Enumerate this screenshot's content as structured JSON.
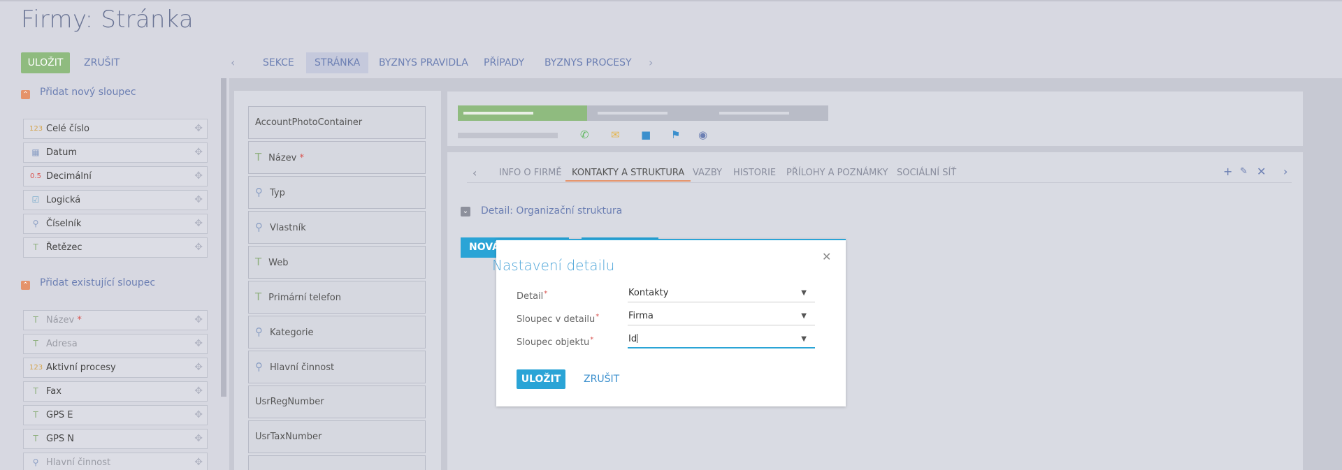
{
  "page": {
    "title": "Firmy: Stránka"
  },
  "toolbar": {
    "save_label": "ULOŽIT",
    "cancel_label": "ZRUŠIT"
  },
  "top_tabs": [
    "SEKCE",
    "STRÁNKA",
    "BYZNYS PRAVIDLA",
    "PŘÍPADY",
    "BYZNYS PROCESY"
  ],
  "left": {
    "new_column_header": "Přidat nový sloupec",
    "new_columns": [
      {
        "icon": "123",
        "label": "Celé číslo"
      },
      {
        "icon": "calendar-icon",
        "label": "Datum"
      },
      {
        "icon": "0.5",
        "label": "Decimální"
      },
      {
        "icon": "checkbox-icon",
        "label": "Logická"
      },
      {
        "icon": "search-icon",
        "label": "Číselník"
      },
      {
        "icon": "T",
        "label": "Řetězec"
      }
    ],
    "existing_column_header": "Přidat existující sloupec",
    "existing_columns": [
      {
        "icon": "T",
        "label": "Název",
        "required": "*"
      },
      {
        "icon": "T",
        "label": "Adresa"
      },
      {
        "icon": "123",
        "label": "Aktivní procesy"
      },
      {
        "icon": "T",
        "label": "Fax"
      },
      {
        "icon": "T",
        "label": "GPS E"
      },
      {
        "icon": "T",
        "label": "GPS N"
      },
      {
        "icon": "search-icon",
        "label": "Hlavní činnost"
      }
    ]
  },
  "middle": {
    "cards": [
      {
        "label": "AccountPhotoContainer"
      },
      {
        "icon": "T",
        "label": "Název",
        "required": "*"
      },
      {
        "icon": "search",
        "label": "Typ"
      },
      {
        "icon": "search",
        "label": "Vlastník"
      },
      {
        "icon": "T",
        "label": "Web"
      },
      {
        "icon": "T",
        "label": "Primární telefon"
      },
      {
        "icon": "search",
        "label": "Kategorie"
      },
      {
        "icon": "search",
        "label": "Hlavní činnost"
      },
      {
        "label": "UsrRegNumber"
      },
      {
        "label": "UsrTaxNumber"
      }
    ]
  },
  "right": {
    "detail_tabs": [
      "INFO O FIRMĚ",
      "KONTAKTY A STRUKTURA",
      "VAZBY",
      "HISTORIE",
      "PŘÍLOHY A POZNÁMKY",
      "SOCIÁLNÍ SÍŤ"
    ],
    "active_tab": "KONTAKTY A STRUKTURA",
    "detail_label": "Detail: Organizační struktura",
    "new_button_label": "NOVÁ",
    "colors": {
      "accent": "#2aa4d6",
      "save_green": "#8fbb7f",
      "orange": "#e5936a"
    }
  },
  "modal": {
    "title": "Nastavení detailu",
    "fields": [
      {
        "label": "Detail",
        "value": "Kontakty"
      },
      {
        "label": "Sloupec v detailu",
        "value": "Firma"
      },
      {
        "label": "Sloupec objektu",
        "value": "Id"
      }
    ],
    "required_mark": "*",
    "save_label": "ULOŽIT",
    "cancel_label": "ZRUŠIT"
  }
}
